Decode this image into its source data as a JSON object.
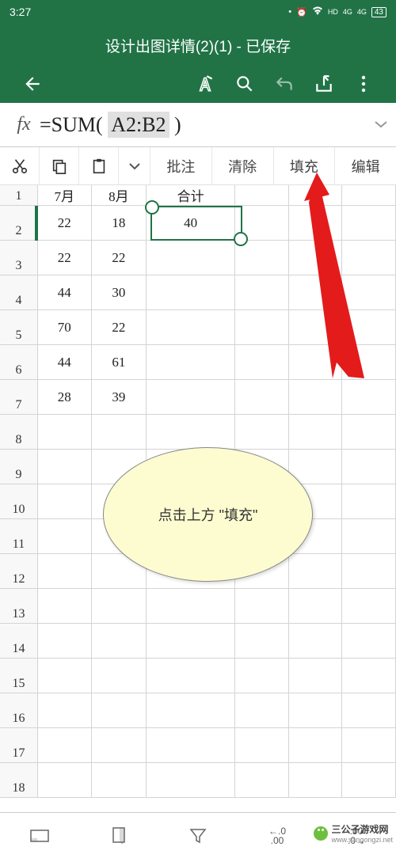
{
  "status": {
    "time": "3:27",
    "battery": "43",
    "net1": "4G",
    "net2": "4G",
    "hd": "HD"
  },
  "header": {
    "title": "设计出图详情(2)(1) - 已保存"
  },
  "formula": {
    "fx": "fx",
    "prefix": "=SUM( ",
    "ref": "A2:B2",
    "suffix": " )"
  },
  "toolbar": {
    "comment": "批注",
    "clear": "清除",
    "fill": "填充",
    "edit": "编辑"
  },
  "col_headers": {
    "a": "7月",
    "b": "8月",
    "c": "合计"
  },
  "rows": [
    {
      "n": "1"
    },
    {
      "n": "2",
      "a": "22",
      "b": "18",
      "c": "40"
    },
    {
      "n": "3",
      "a": "22",
      "b": "22"
    },
    {
      "n": "4",
      "a": "44",
      "b": "30"
    },
    {
      "n": "5",
      "a": "70",
      "b": "22"
    },
    {
      "n": "6",
      "a": "44",
      "b": "61"
    },
    {
      "n": "7",
      "a": "28",
      "b": "39"
    },
    {
      "n": "8"
    },
    {
      "n": "9"
    },
    {
      "n": "10"
    },
    {
      "n": "11"
    },
    {
      "n": "12"
    },
    {
      "n": "13"
    },
    {
      "n": "14"
    },
    {
      "n": "15"
    },
    {
      "n": "16"
    },
    {
      "n": "17"
    },
    {
      "n": "18"
    }
  ],
  "annotation": {
    "text": "点击上方 \"填充\""
  },
  "bottom": {
    "dec_left": "←.0\n.00",
    "dec_right": ".00\n.0→"
  },
  "watermark": {
    "text": "三公子游戏网",
    "url": "www.sangongzi.net"
  }
}
